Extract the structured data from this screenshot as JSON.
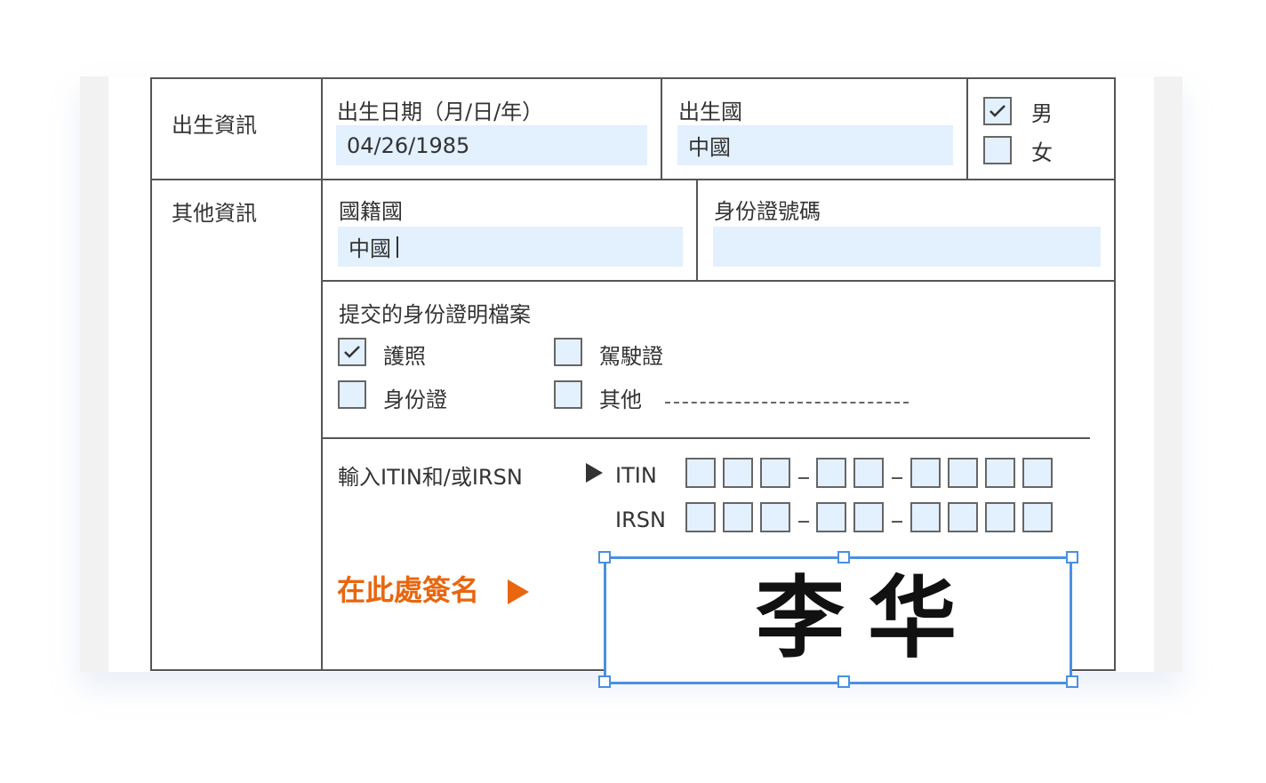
{
  "birth_section": {
    "label": "出生資訊",
    "dob": {
      "label": "出生日期（月/日/年）",
      "value": "04/26/1985"
    },
    "country": {
      "label": "出生國",
      "value": "中國"
    },
    "gender": {
      "options": [
        {
          "label": "男",
          "checked": true
        },
        {
          "label": "女",
          "checked": false
        }
      ]
    }
  },
  "other_section": {
    "label": "其他資訊",
    "nationality": {
      "label": "國籍國",
      "value": "中國"
    },
    "id_number": {
      "label": "身份證號碼",
      "value": ""
    },
    "documents": {
      "label": "提交的身份證明檔案",
      "options": [
        {
          "label": "護照",
          "checked": true
        },
        {
          "label": "駕駛證",
          "checked": false
        },
        {
          "label": "身份證",
          "checked": false
        },
        {
          "label": "其他",
          "checked": false
        }
      ]
    },
    "itin_irsn": {
      "label": "輸入ITIN和/或IRSN",
      "itin_label": "ITIN",
      "irsn_label": "IRSN"
    },
    "signature": {
      "cta": "在此處簽名",
      "value": "李华"
    }
  },
  "colors": {
    "field_bg": "#e3f0fe",
    "accent": "#e8660f",
    "selection": "#4a90e2"
  }
}
